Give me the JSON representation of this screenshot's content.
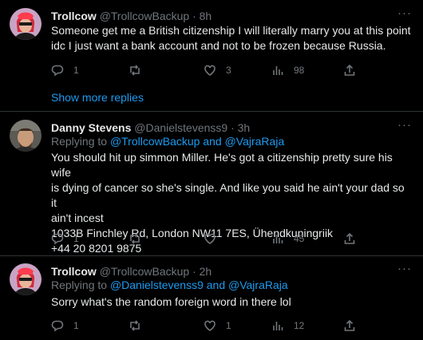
{
  "tweets": [
    {
      "name": "Trollcow",
      "handle": "@TrollcowBackup",
      "time": "· 8h",
      "replying_prefix": "",
      "replying_to": "",
      "body": "Someone get me a British citizenship I will literally marry you at this point\nidc I just want a bank account and not to be frozen because Russia.",
      "actions": {
        "replies": "1",
        "retweets": "",
        "likes": "3",
        "views": "98"
      }
    },
    {
      "name": "Danny Stevens",
      "handle": "@Danielstevenss9",
      "time": "· 3h",
      "replying_prefix": "Replying to ",
      "replying_to": "@TrollcowBackup and @VajraRaja",
      "body": "You should hit up simmon Miller. He's got a citizenship pretty sure his wife\nis dying of cancer so she's single. And like you said he ain't your dad so it\nain't incest\n1033B Finchley Rd, London NW11 7ES, Ühendkuningriik\n+44 20 8201 9875",
      "actions": {
        "replies": "1",
        "retweets": "",
        "likes": "",
        "views": "45"
      }
    },
    {
      "name": "Trollcow",
      "handle": "@TrollcowBackup",
      "time": "· 2h",
      "replying_prefix": "Replying to ",
      "replying_to": "@Danielstevenss9 and @VajraRaja",
      "body": "Sorry what's the random foreign word in there lol",
      "actions": {
        "replies": "1",
        "retweets": "",
        "likes": "1",
        "views": "12"
      }
    }
  ],
  "show_more_replies": "Show more replies",
  "more_glyph": "···",
  "colors": {
    "link": "#1d9bf0",
    "muted": "#71767b",
    "text": "#e7e9ea",
    "bg": "#000000"
  }
}
